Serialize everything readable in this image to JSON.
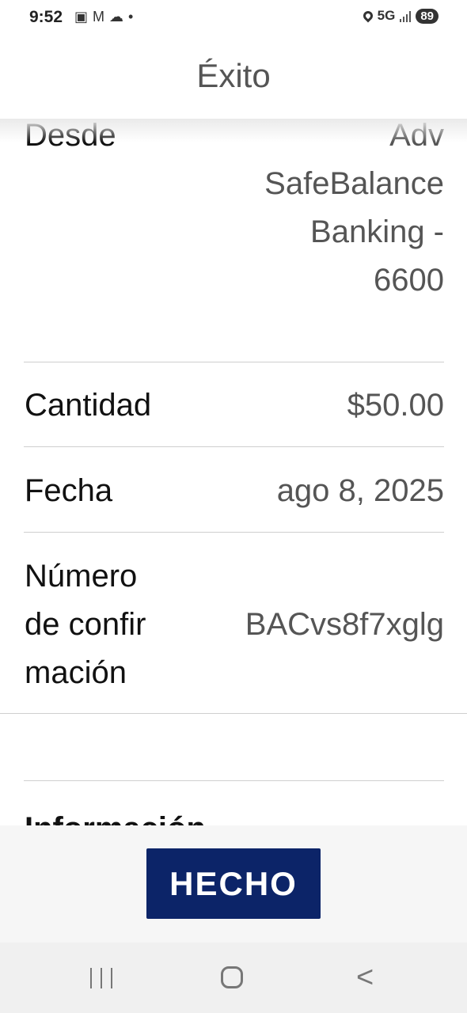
{
  "status_bar": {
    "time": "9:52",
    "network": "5G",
    "battery": "89",
    "icons": [
      "screenshot-icon",
      "gmail-icon",
      "cloud-icon",
      "dot-icon",
      "location-icon",
      "signal-icon",
      "battery-icon"
    ]
  },
  "header": {
    "title": "Éxito"
  },
  "details": {
    "from_label": "Desde",
    "from_value": [
      "Adv",
      "SafeBalance",
      "Banking -",
      "6600"
    ],
    "amount_label": "Cantidad",
    "amount_value": "$50.00",
    "date_label": "Fecha",
    "date_value": "ago 8, 2025",
    "confirmation_label": [
      "Número",
      "de confir",
      "mación"
    ],
    "confirmation_value": "BACvs8f7xglg",
    "info_label": "Información"
  },
  "actions": {
    "done_label": "HECHO"
  },
  "colors": {
    "button": "#0c2468",
    "label": "#111111",
    "value": "#555555"
  }
}
